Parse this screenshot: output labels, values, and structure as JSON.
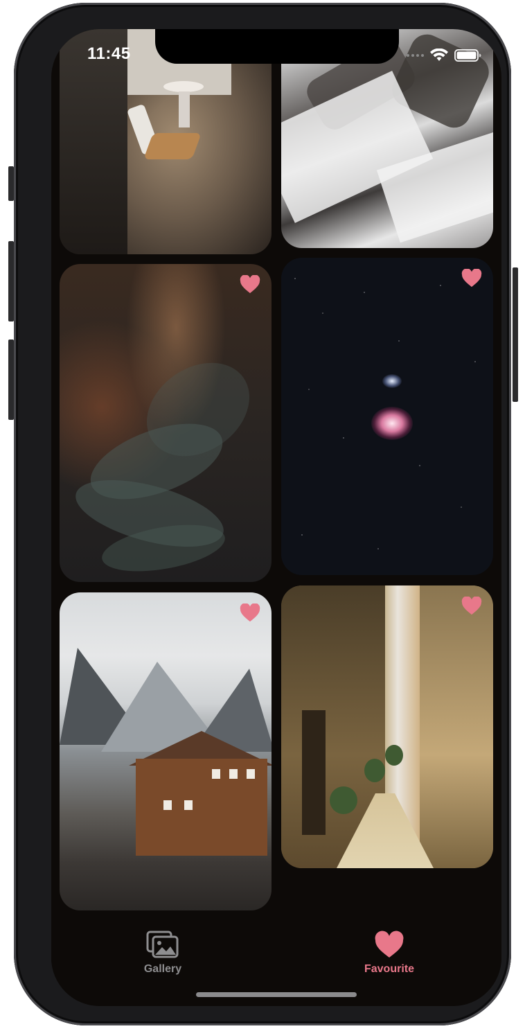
{
  "status_bar": {
    "time": "11:45",
    "signal_icon": "signal-dots-icon",
    "wifi_icon": "wifi-icon",
    "battery_icon": "battery-icon"
  },
  "grid": {
    "items": [
      {
        "id": "chair-sunlight",
        "favourite_icon_visible": false
      },
      {
        "id": "snowy-mountain",
        "favourite_icon_visible": false
      },
      {
        "id": "pine-branch",
        "favourite_icon_visible": true
      },
      {
        "id": "orion-nebula",
        "favourite_icon_visible": true
      },
      {
        "id": "mountain-house",
        "favourite_icon_visible": true
      },
      {
        "id": "narrow-alley",
        "favourite_icon_visible": true
      }
    ]
  },
  "tabbar": {
    "gallery_label": "Gallery",
    "favourite_label": "Favourite",
    "gallery_icon": "photos-icon",
    "favourite_icon": "heart-icon"
  },
  "colors": {
    "background": "#0d0a08",
    "accent": "#e8788a",
    "inactive": "#8e8e90"
  }
}
